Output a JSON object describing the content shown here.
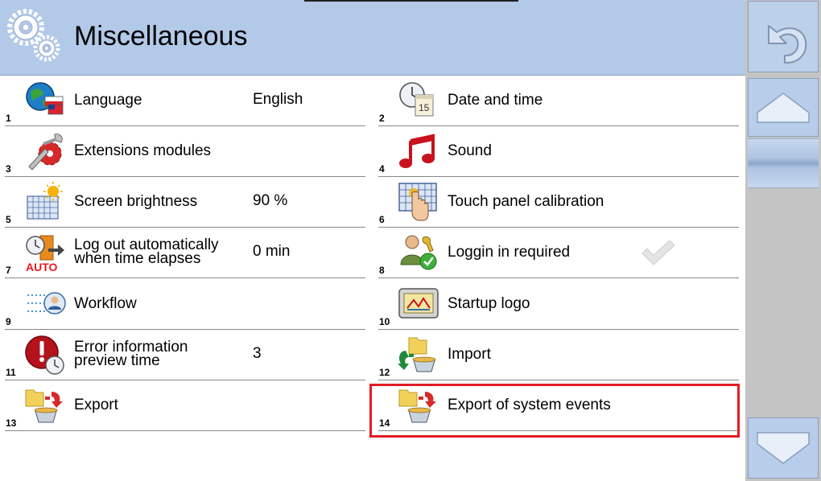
{
  "header": {
    "title": "Miscellaneous",
    "icon": "gears-icon"
  },
  "sidebar": {
    "back_icon": "undo-arrow-icon",
    "up_icon": "arrow-up-icon",
    "down_icon": "arrow-down-icon"
  },
  "items": [
    {
      "num": "1",
      "label": "Language",
      "value": "English",
      "icon": "language-globe-icon"
    },
    {
      "num": "2",
      "label": "Date and time",
      "value": "",
      "icon": "clock-calendar-icon",
      "calendar_day": "15"
    },
    {
      "num": "3",
      "label": "Extensions modules",
      "value": "",
      "icon": "wrench-gear-icon"
    },
    {
      "num": "4",
      "label": "Sound",
      "value": "",
      "icon": "music-note-icon"
    },
    {
      "num": "5",
      "label": "Screen brightness",
      "value": "90 %",
      "icon": "brightness-icon"
    },
    {
      "num": "6",
      "label": "Touch panel calibration",
      "value": "",
      "icon": "touch-hand-icon"
    },
    {
      "num": "7",
      "label": "Log out automatically\nwhen time elapses",
      "value": "0 min",
      "icon": "auto-logout-icon",
      "badge": "AUTO"
    },
    {
      "num": "8",
      "label": "Loggin in required",
      "value": "",
      "icon": "user-check-icon",
      "checked": true
    },
    {
      "num": "9",
      "label": "Workflow",
      "value": "",
      "icon": "workflow-user-icon"
    },
    {
      "num": "10",
      "label": "Startup logo",
      "value": "",
      "icon": "startup-logo-icon"
    },
    {
      "num": "11",
      "label": "Error information\npreview time",
      "value": "3",
      "icon": "error-clock-icon"
    },
    {
      "num": "12",
      "label": "Import",
      "value": "",
      "icon": "import-folder-icon"
    },
    {
      "num": "13",
      "label": "Export",
      "value": "",
      "icon": "export-folder-icon"
    },
    {
      "num": "14",
      "label": "Export of system events",
      "value": "",
      "icon": "export-events-icon",
      "selected": true
    }
  ],
  "colors": {
    "header_bg": "#b2c9e8",
    "selection": "#e21b23",
    "sidebar_bg": "#c4c4c4"
  }
}
